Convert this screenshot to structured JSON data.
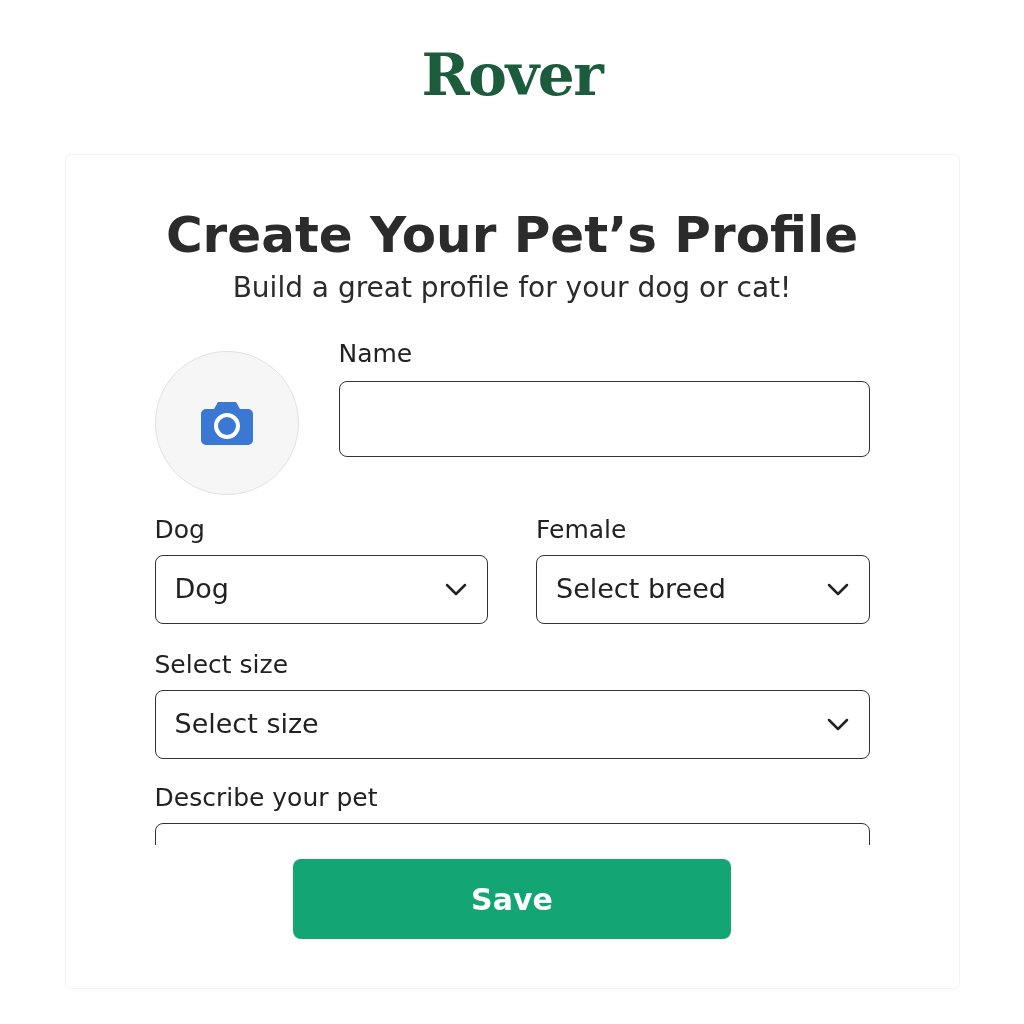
{
  "logo": "Rover",
  "title": "Create Your Pet’s Profile",
  "subtitle": "Build a great profile for your dog or cat!",
  "name_field": {
    "label": "Name"
  },
  "selects": [
    {
      "label": "Dog",
      "value": "Dog"
    },
    {
      "label": "Female",
      "placeholder": "Select breed"
    }
  ],
  "size_field": {
    "label": "Select size",
    "placeholder": "Select size"
  },
  "description_field": {
    "label": "Describe your pet"
  },
  "save_button": "Save"
}
